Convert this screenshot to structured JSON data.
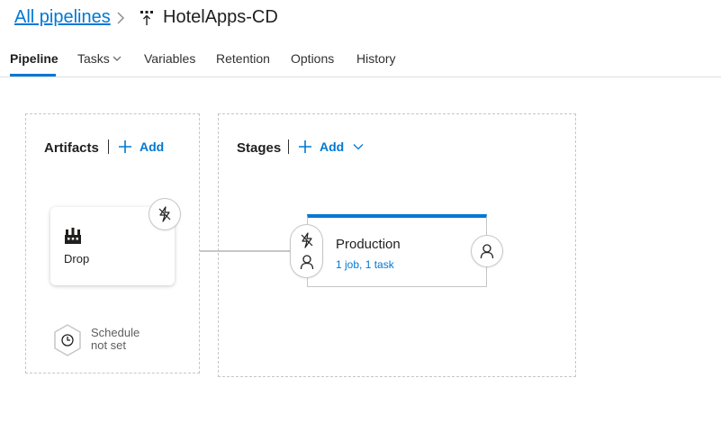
{
  "breadcrumb": {
    "all_pipelines": "All pipelines",
    "pipeline_name": "HotelApps-CD"
  },
  "tabs": [
    {
      "label": "Pipeline",
      "active": true
    },
    {
      "label": "Tasks",
      "has_dropdown": true
    },
    {
      "label": "Variables"
    },
    {
      "label": "Retention"
    },
    {
      "label": "Options"
    },
    {
      "label": "History"
    }
  ],
  "artifacts": {
    "title": "Artifacts",
    "add_label": "Add",
    "items": [
      {
        "name": "Drop",
        "icon": "build-artifact-icon",
        "trigger_icon": "continuous-deployment-trigger-icon"
      }
    ],
    "schedule": {
      "line1": "Schedule",
      "line2": "not set",
      "icon": "clock-icon"
    }
  },
  "stages": {
    "title": "Stages",
    "add_label": "Add",
    "items": [
      {
        "name": "Production",
        "summary": "1 job, 1 task",
        "accent": "#0078d4"
      }
    ]
  },
  "colors": {
    "accent": "#0078d4",
    "text": "#201f1e",
    "muted": "#605e5c",
    "border": "#c8c6c4"
  }
}
